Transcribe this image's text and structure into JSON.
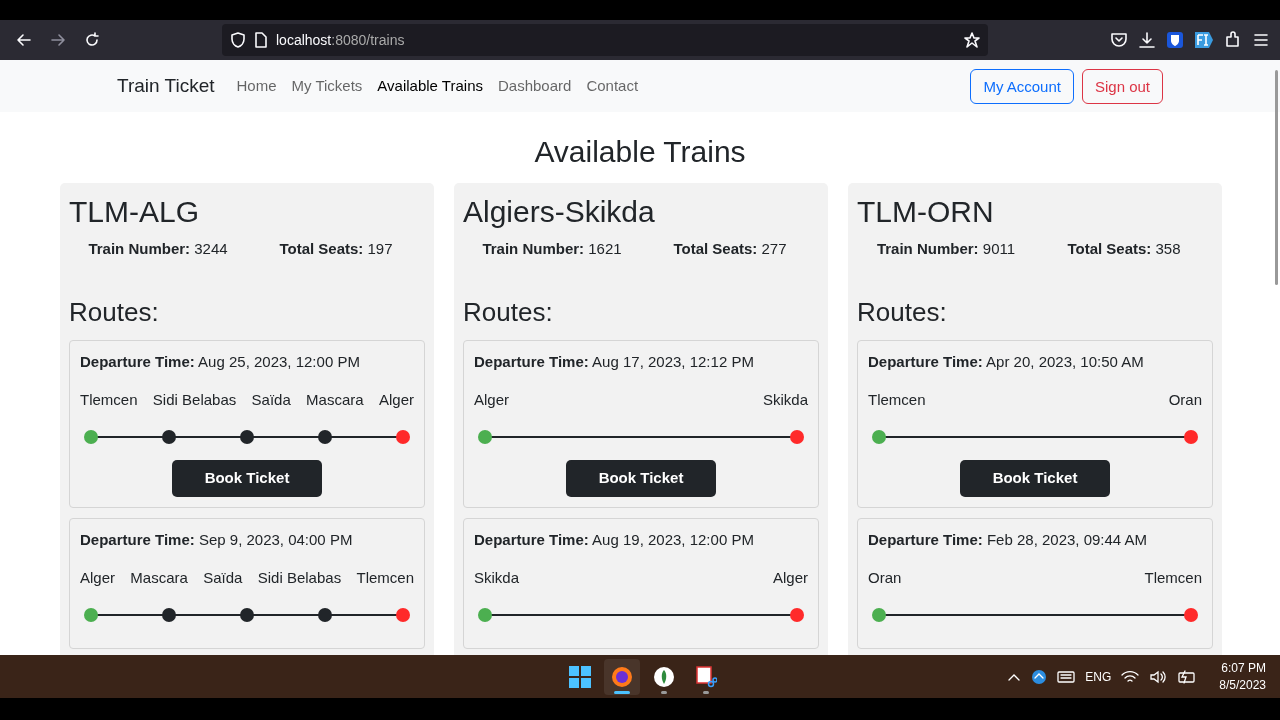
{
  "browser": {
    "url_host": "localhost",
    "url_path": ":8080/trains"
  },
  "navbar": {
    "brand": "Train Ticket",
    "links": [
      {
        "label": "Home",
        "selected": false
      },
      {
        "label": "My Tickets",
        "selected": false
      },
      {
        "label": "Available Trains",
        "selected": true
      },
      {
        "label": "Dashboard",
        "selected": false
      },
      {
        "label": "Contact",
        "selected": false
      }
    ],
    "buttons": [
      {
        "label": "My Account",
        "kind": "primary"
      },
      {
        "label": "Sign out",
        "kind": "danger"
      }
    ]
  },
  "heading": "Available Trains",
  "trains": [
    {
      "name": "TLM-ALG",
      "number_label": "Train Number:",
      "number": "3244",
      "seats_label": "Total Seats:",
      "seats": "197",
      "routes_heading": "Routes:",
      "routes": [
        {
          "departure_label": "Departure Time:",
          "departure": "Aug 25, 2023, 12:00 PM",
          "stations": [
            {
              "name": "Tlemcen",
              "color": "#4caf50"
            },
            {
              "name": "Sidi Belabas",
              "color": "#212529"
            },
            {
              "name": "Saïda",
              "color": "#212529"
            },
            {
              "name": "Mascara",
              "color": "#212529"
            },
            {
              "name": "Alger",
              "color": "#ff2a2a"
            }
          ],
          "button": "Book Ticket"
        },
        {
          "departure_label": "Departure Time:",
          "departure": "Sep 9, 2023, 04:00 PM",
          "stations": [
            {
              "name": "Alger",
              "color": "#4caf50"
            },
            {
              "name": "Mascara",
              "color": "#212529"
            },
            {
              "name": "Saïda",
              "color": "#212529"
            },
            {
              "name": "Sidi Belabas",
              "color": "#212529"
            },
            {
              "name": "Tlemcen",
              "color": "#ff2a2a"
            }
          ]
        }
      ]
    },
    {
      "name": "Algiers-Skikda",
      "number_label": "Train Number:",
      "number": "1621",
      "seats_label": "Total Seats:",
      "seats": "277",
      "routes_heading": "Routes:",
      "routes": [
        {
          "departure_label": "Departure Time:",
          "departure": "Aug 17, 2023, 12:12 PM",
          "stations": [
            {
              "name": "Alger",
              "color": "#4caf50"
            },
            {
              "name": "Skikda",
              "color": "#ff2a2a"
            }
          ],
          "button": "Book Ticket"
        },
        {
          "departure_label": "Departure Time:",
          "departure": "Aug 19, 2023, 12:00 PM",
          "stations": [
            {
              "name": "Skikda",
              "color": "#4caf50"
            },
            {
              "name": "Alger",
              "color": "#ff2a2a"
            }
          ]
        }
      ]
    },
    {
      "name": "TLM-ORN",
      "number_label": "Train Number:",
      "number": "9011",
      "seats_label": "Total Seats:",
      "seats": "358",
      "routes_heading": "Routes:",
      "routes": [
        {
          "departure_label": "Departure Time:",
          "departure": "Apr 20, 2023, 10:50 AM",
          "stations": [
            {
              "name": "Tlemcen",
              "color": "#4caf50"
            },
            {
              "name": "Oran",
              "color": "#ff2a2a"
            }
          ],
          "button": "Book Ticket"
        },
        {
          "departure_label": "Departure Time:",
          "departure": "Feb 28, 2023, 09:44 AM",
          "stations": [
            {
              "name": "Oran",
              "color": "#4caf50"
            },
            {
              "name": "Tlemcen",
              "color": "#ff2a2a"
            }
          ]
        }
      ]
    }
  ],
  "taskbar": {
    "apps": [
      {
        "kind": "browser",
        "selected": true
      },
      {
        "kind": "database",
        "selected": false
      },
      {
        "kind": "snipping",
        "selected": false
      }
    ],
    "language": "ENG",
    "time": "6:07 PM",
    "date": "8/5/2023"
  }
}
